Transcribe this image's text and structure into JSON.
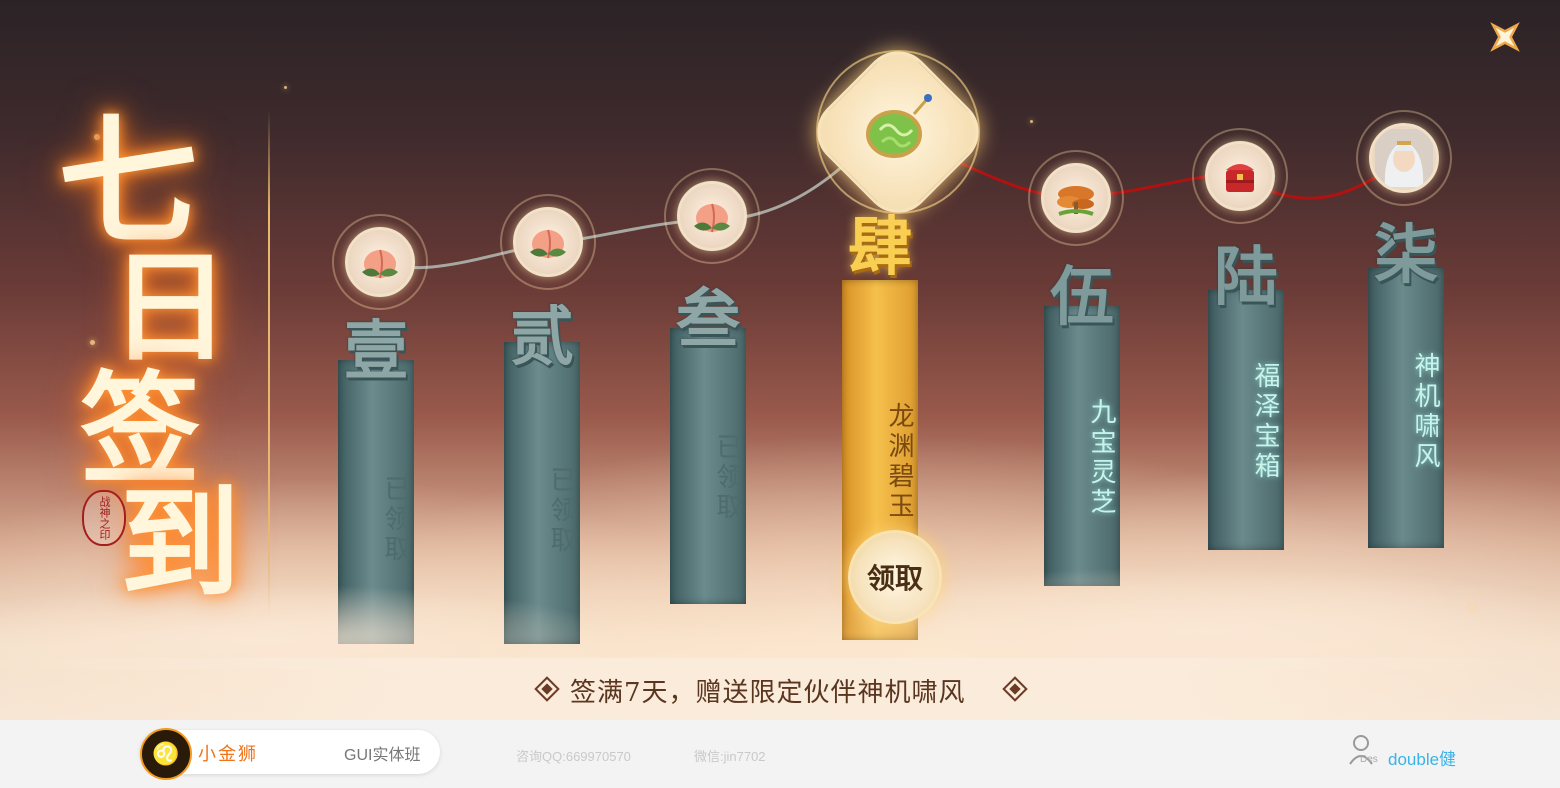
{
  "title": {
    "chars": [
      "七",
      "日",
      "签",
      "到"
    ],
    "seal_text": "战神之印"
  },
  "days": [
    {
      "numeral": "壹",
      "label": "已领取",
      "state": "claimed",
      "reward_icon": "peach-icon"
    },
    {
      "numeral": "贰",
      "label": "已领取",
      "state": "claimed",
      "reward_icon": "peach-icon"
    },
    {
      "numeral": "叁",
      "label": "已领取",
      "state": "claimed",
      "reward_icon": "peach-icon"
    },
    {
      "numeral": "肆",
      "label": "龙渊碧玉",
      "state": "current",
      "reward_icon": "jade-pendant-icon"
    },
    {
      "numeral": "伍",
      "label": "九宝灵芝",
      "state": "future",
      "reward_icon": "lingzhi-mushroom-icon"
    },
    {
      "numeral": "陆",
      "label": "福泽宝箱",
      "state": "future",
      "reward_icon": "treasure-chest-icon"
    },
    {
      "numeral": "柒",
      "label": "神机啸风",
      "state": "future",
      "reward_icon": "companion-portrait-icon"
    }
  ],
  "claim_button": "领取",
  "reward_text": "签满7天，赠送限定伙伴神机啸风",
  "close_icon": "close-x-icon",
  "footer": {
    "brand_name": "小金狮",
    "course": "GUI实体班",
    "qq": "咨询QQ:669970570",
    "wechat": "微信:jin7702",
    "user_name": "double健",
    "user_tag": "Des"
  },
  "colors": {
    "gold": "#f6c04c",
    "teal_stone": "#6a8a8c",
    "brand_orange": "#f0731a",
    "user_blue": "#3ab3e8"
  }
}
